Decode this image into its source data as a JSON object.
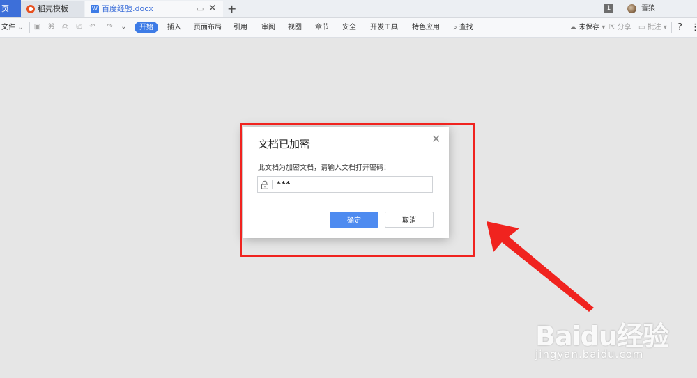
{
  "tabs": {
    "home_label": "页",
    "daoke_label": "稻壳模板",
    "doc_label": "百度经验.docx",
    "doc_icon_letter": "W",
    "new_tab": "+",
    "window_badge": "1",
    "user_name": "雪狼"
  },
  "toolbar": {
    "file_label": "文件",
    "menu": [
      "开始",
      "插入",
      "页面布局",
      "引用",
      "审阅",
      "视图",
      "章节",
      "安全",
      "开发工具",
      "特色应用"
    ],
    "search_label": "查找",
    "unsaved_label": "未保存",
    "share_label": "分享",
    "comment_label": "批注",
    "help_label": "?"
  },
  "dialog": {
    "title": "文档已加密",
    "prompt": "此文档为加密文档，请输入文档打开密码：",
    "password_value": "***",
    "ok_label": "确定",
    "cancel_label": "取消"
  },
  "annotation": {
    "highlight_color": "#f0231f",
    "arrow_color": "#f0231f"
  },
  "watermark": {
    "brand": "Baidu经验",
    "url": "jingyan.baidu.com"
  }
}
